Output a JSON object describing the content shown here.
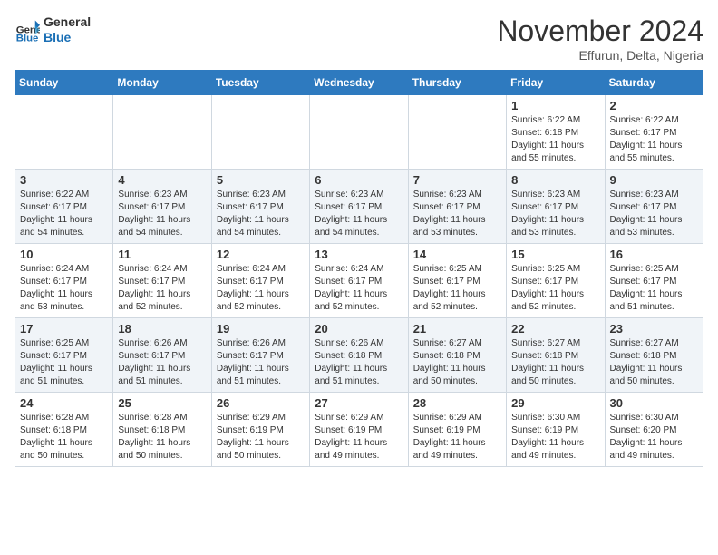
{
  "logo": {
    "line1": "General",
    "line2": "Blue"
  },
  "title": "November 2024",
  "subtitle": "Effurun, Delta, Nigeria",
  "weekdays": [
    "Sunday",
    "Monday",
    "Tuesday",
    "Wednesday",
    "Thursday",
    "Friday",
    "Saturday"
  ],
  "weeks": [
    [
      {
        "day": "",
        "info": ""
      },
      {
        "day": "",
        "info": ""
      },
      {
        "day": "",
        "info": ""
      },
      {
        "day": "",
        "info": ""
      },
      {
        "day": "",
        "info": ""
      },
      {
        "day": "1",
        "info": "Sunrise: 6:22 AM\nSunset: 6:18 PM\nDaylight: 11 hours\nand 55 minutes."
      },
      {
        "day": "2",
        "info": "Sunrise: 6:22 AM\nSunset: 6:17 PM\nDaylight: 11 hours\nand 55 minutes."
      }
    ],
    [
      {
        "day": "3",
        "info": "Sunrise: 6:22 AM\nSunset: 6:17 PM\nDaylight: 11 hours\nand 54 minutes."
      },
      {
        "day": "4",
        "info": "Sunrise: 6:23 AM\nSunset: 6:17 PM\nDaylight: 11 hours\nand 54 minutes."
      },
      {
        "day": "5",
        "info": "Sunrise: 6:23 AM\nSunset: 6:17 PM\nDaylight: 11 hours\nand 54 minutes."
      },
      {
        "day": "6",
        "info": "Sunrise: 6:23 AM\nSunset: 6:17 PM\nDaylight: 11 hours\nand 54 minutes."
      },
      {
        "day": "7",
        "info": "Sunrise: 6:23 AM\nSunset: 6:17 PM\nDaylight: 11 hours\nand 53 minutes."
      },
      {
        "day": "8",
        "info": "Sunrise: 6:23 AM\nSunset: 6:17 PM\nDaylight: 11 hours\nand 53 minutes."
      },
      {
        "day": "9",
        "info": "Sunrise: 6:23 AM\nSunset: 6:17 PM\nDaylight: 11 hours\nand 53 minutes."
      }
    ],
    [
      {
        "day": "10",
        "info": "Sunrise: 6:24 AM\nSunset: 6:17 PM\nDaylight: 11 hours\nand 53 minutes."
      },
      {
        "day": "11",
        "info": "Sunrise: 6:24 AM\nSunset: 6:17 PM\nDaylight: 11 hours\nand 52 minutes."
      },
      {
        "day": "12",
        "info": "Sunrise: 6:24 AM\nSunset: 6:17 PM\nDaylight: 11 hours\nand 52 minutes."
      },
      {
        "day": "13",
        "info": "Sunrise: 6:24 AM\nSunset: 6:17 PM\nDaylight: 11 hours\nand 52 minutes."
      },
      {
        "day": "14",
        "info": "Sunrise: 6:25 AM\nSunset: 6:17 PM\nDaylight: 11 hours\nand 52 minutes."
      },
      {
        "day": "15",
        "info": "Sunrise: 6:25 AM\nSunset: 6:17 PM\nDaylight: 11 hours\nand 52 minutes."
      },
      {
        "day": "16",
        "info": "Sunrise: 6:25 AM\nSunset: 6:17 PM\nDaylight: 11 hours\nand 51 minutes."
      }
    ],
    [
      {
        "day": "17",
        "info": "Sunrise: 6:25 AM\nSunset: 6:17 PM\nDaylight: 11 hours\nand 51 minutes."
      },
      {
        "day": "18",
        "info": "Sunrise: 6:26 AM\nSunset: 6:17 PM\nDaylight: 11 hours\nand 51 minutes."
      },
      {
        "day": "19",
        "info": "Sunrise: 6:26 AM\nSunset: 6:17 PM\nDaylight: 11 hours\nand 51 minutes."
      },
      {
        "day": "20",
        "info": "Sunrise: 6:26 AM\nSunset: 6:18 PM\nDaylight: 11 hours\nand 51 minutes."
      },
      {
        "day": "21",
        "info": "Sunrise: 6:27 AM\nSunset: 6:18 PM\nDaylight: 11 hours\nand 50 minutes."
      },
      {
        "day": "22",
        "info": "Sunrise: 6:27 AM\nSunset: 6:18 PM\nDaylight: 11 hours\nand 50 minutes."
      },
      {
        "day": "23",
        "info": "Sunrise: 6:27 AM\nSunset: 6:18 PM\nDaylight: 11 hours\nand 50 minutes."
      }
    ],
    [
      {
        "day": "24",
        "info": "Sunrise: 6:28 AM\nSunset: 6:18 PM\nDaylight: 11 hours\nand 50 minutes."
      },
      {
        "day": "25",
        "info": "Sunrise: 6:28 AM\nSunset: 6:18 PM\nDaylight: 11 hours\nand 50 minutes."
      },
      {
        "day": "26",
        "info": "Sunrise: 6:29 AM\nSunset: 6:19 PM\nDaylight: 11 hours\nand 50 minutes."
      },
      {
        "day": "27",
        "info": "Sunrise: 6:29 AM\nSunset: 6:19 PM\nDaylight: 11 hours\nand 49 minutes."
      },
      {
        "day": "28",
        "info": "Sunrise: 6:29 AM\nSunset: 6:19 PM\nDaylight: 11 hours\nand 49 minutes."
      },
      {
        "day": "29",
        "info": "Sunrise: 6:30 AM\nSunset: 6:19 PM\nDaylight: 11 hours\nand 49 minutes."
      },
      {
        "day": "30",
        "info": "Sunrise: 6:30 AM\nSunset: 6:20 PM\nDaylight: 11 hours\nand 49 minutes."
      }
    ]
  ]
}
